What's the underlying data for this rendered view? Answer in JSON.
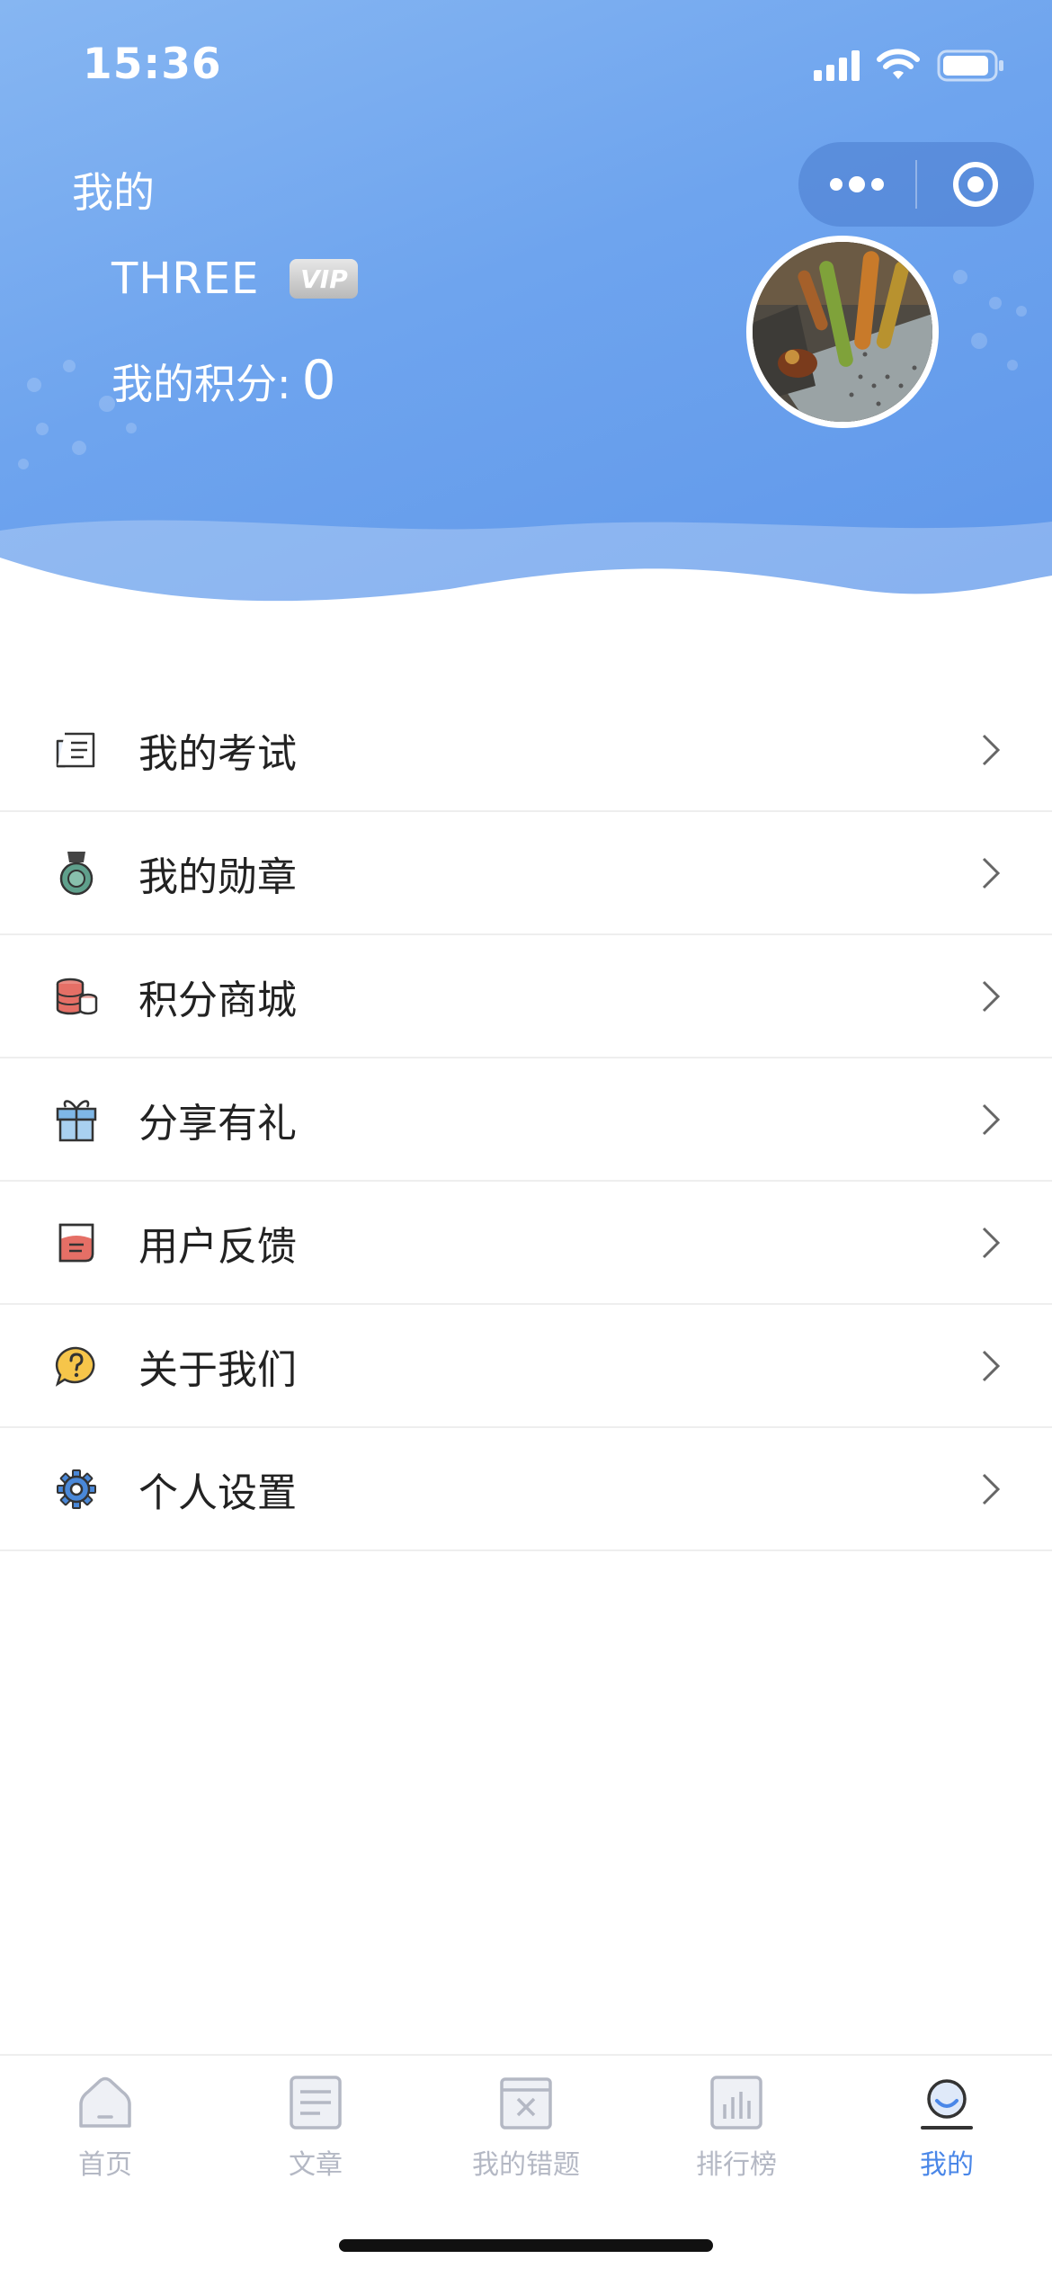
{
  "status_bar": {
    "time": "15:36",
    "icons": [
      "signal-icon",
      "wifi-icon",
      "battery-icon"
    ]
  },
  "header": {
    "title": "我的",
    "username": "THREE",
    "vip_badge": "VIP",
    "points_label": "我的积分:",
    "points_value": "0"
  },
  "capsule": {
    "icons": [
      "more-dots-icon",
      "close-target-icon"
    ]
  },
  "menu": {
    "items": [
      {
        "label": "我的考试",
        "icon": "exam-doc-icon"
      },
      {
        "label": "我的勋章",
        "icon": "medal-icon"
      },
      {
        "label": "积分商城",
        "icon": "coins-icon"
      },
      {
        "label": "分享有礼",
        "icon": "gift-icon"
      },
      {
        "label": "用户反馈",
        "icon": "feedback-icon"
      },
      {
        "label": "关于我们",
        "icon": "help-bubble-icon"
      },
      {
        "label": "个人设置",
        "icon": "gear-icon"
      }
    ]
  },
  "tabbar": {
    "tabs": [
      {
        "label": "首页",
        "icon": "home-icon",
        "active": false
      },
      {
        "label": "文章",
        "icon": "article-icon",
        "active": false
      },
      {
        "label": "我的错题",
        "icon": "wrong-questions-icon",
        "active": false
      },
      {
        "label": "排行榜",
        "icon": "leaderboard-icon",
        "active": false
      },
      {
        "label": "我的",
        "icon": "profile-icon",
        "active": true
      }
    ]
  },
  "colors": {
    "header_gradient_start": "#86b6f2",
    "header_gradient_end": "#5f97ea",
    "tab_active": "#4a87e8",
    "tab_inactive": "#b4b8c4"
  }
}
